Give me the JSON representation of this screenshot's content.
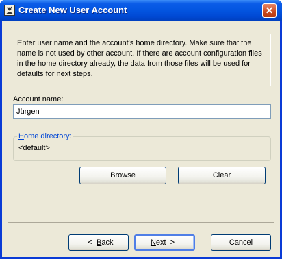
{
  "window": {
    "title": "Create New User Account",
    "close_glyph": "✕"
  },
  "info": {
    "text": "Enter user name and the account's home directory. Make sure that the name is not used by other account. If there are account configuration files in the home directory already, the data from those files will be used for defaults for next steps."
  },
  "account": {
    "label": "Account name:",
    "value": "Jürgen"
  },
  "home": {
    "label_first": "H",
    "label_rest": "ome directory:",
    "value": "<default>"
  },
  "buttons": {
    "browse": "Browse",
    "clear": "Clear",
    "back_arrow": "<",
    "back_first": "B",
    "back_rest": "ack",
    "next_first": "N",
    "next_rest": "ext",
    "next_arrow": ">",
    "cancel": "Cancel"
  },
  "icons": {
    "app": "user-account-icon",
    "close": "close-icon"
  },
  "colors": {
    "titlebar": "#0355e0",
    "dialog_bg": "#ece9d8",
    "group_label": "#0046d5"
  }
}
